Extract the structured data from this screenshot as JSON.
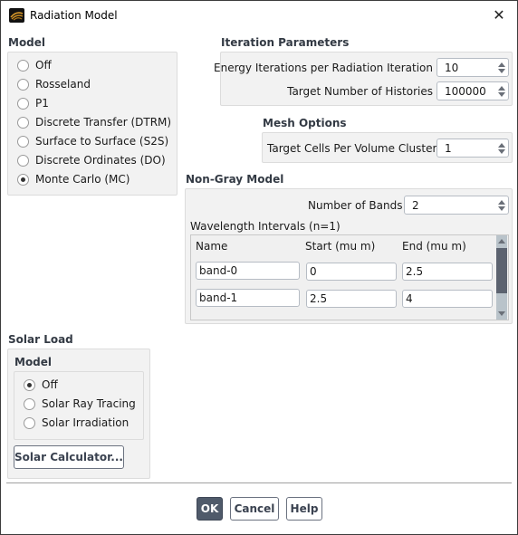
{
  "window": {
    "title": "Radiation Model",
    "close_icon": "close-icon",
    "app_icon": "radiation-app-icon"
  },
  "model": {
    "heading": "Model",
    "options": [
      {
        "label": "Off",
        "checked": false
      },
      {
        "label": "Rosseland",
        "checked": false
      },
      {
        "label": "P1",
        "checked": false
      },
      {
        "label": "Discrete Transfer (DTRM)",
        "checked": false
      },
      {
        "label": "Surface to Surface (S2S)",
        "checked": false
      },
      {
        "label": "Discrete Ordinates (DO)",
        "checked": false
      },
      {
        "label": "Monte Carlo (MC)",
        "checked": true
      }
    ]
  },
  "iteration": {
    "heading": "Iteration Parameters",
    "energy_label": "Energy Iterations per Radiation Iteration",
    "energy_value": "10",
    "histories_label": "Target Number of Histories",
    "histories_value": "100000"
  },
  "mesh": {
    "heading": "Mesh Options",
    "cells_label": "Target Cells Per Volume Cluster",
    "cells_value": "1"
  },
  "nongray": {
    "heading": "Non-Gray Model",
    "bands_label": "Number of Bands",
    "bands_value": "2",
    "intervals_label": "Wavelength Intervals (n=1)",
    "columns": [
      "Name",
      "Start (mu m)",
      "End (mu m)"
    ],
    "rows": [
      [
        "band-0",
        "0",
        "2.5"
      ],
      [
        "band-1",
        "2.5",
        "4"
      ]
    ]
  },
  "solar": {
    "heading": "Solar Load",
    "model_heading": "Model",
    "options": [
      {
        "label": "Off",
        "checked": true
      },
      {
        "label": "Solar Ray Tracing",
        "checked": false
      },
      {
        "label": "Solar Irradiation",
        "checked": false
      }
    ],
    "calculator_label": "Solar Calculator..."
  },
  "footer": {
    "ok": "OK",
    "cancel": "Cancel",
    "help": "Help"
  }
}
